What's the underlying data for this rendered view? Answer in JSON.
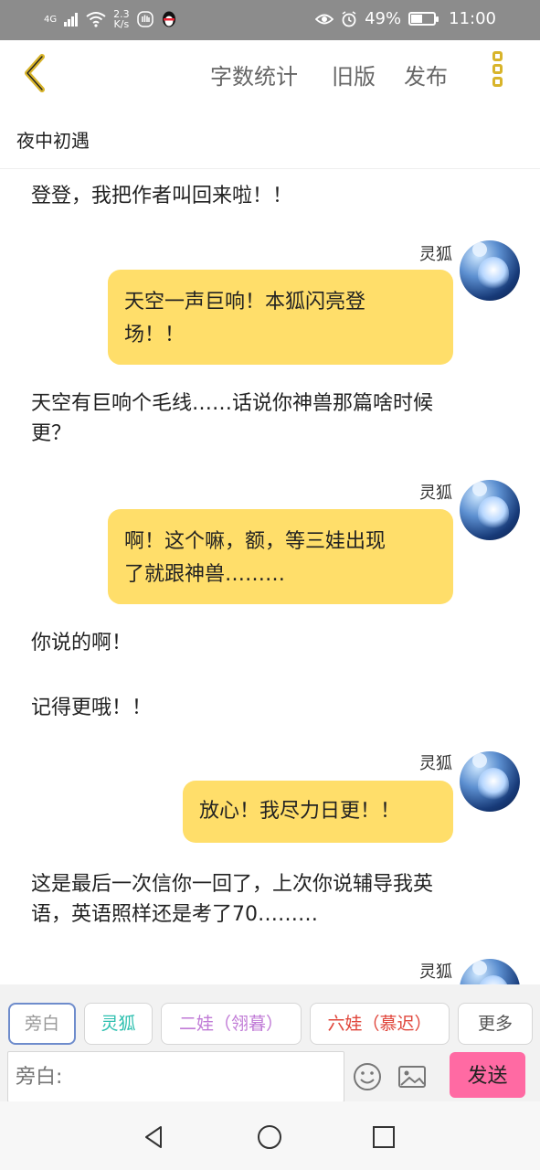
{
  "status_bar": {
    "network": "4G",
    "speed_value": "2.3",
    "speed_unit": "K/s",
    "battery": "49%",
    "battery_level": 0.49,
    "time": "11:00"
  },
  "header": {
    "back_icon": "chevron-left-icon",
    "links": [
      "字数统计",
      "旧版",
      "发布"
    ],
    "more_icon": "three-squares-icon",
    "accent_color": "#d8b42a"
  },
  "story": {
    "title": "夜中初遇"
  },
  "messages": [
    {
      "type": "narration",
      "text": "登登，我把作者叫回来啦！！"
    },
    {
      "type": "character",
      "sender": "灵狐",
      "text_lines": [
        "天空一声巨响！本狐闪亮登",
        "场！！"
      ]
    },
    {
      "type": "narration",
      "text_lines": [
        "天空有巨响个毛线……话说你神兽那篇啥时候",
        "更？"
      ]
    },
    {
      "type": "character",
      "sender": "灵狐",
      "text_lines": [
        "啊！这个嘛，额，等三娃出现",
        "了就跟神兽………"
      ]
    },
    {
      "type": "narration",
      "text": "你说的啊！"
    },
    {
      "type": "narration",
      "text": "记得更哦！！"
    },
    {
      "type": "character",
      "sender": "灵狐",
      "text_lines": [
        "放心！我尽力日更！！"
      ]
    },
    {
      "type": "narration",
      "text_lines": [
        "这是最后一次信你一回了，上次你说辅导我英",
        "语，英语照样还是考了70………"
      ]
    },
    {
      "type": "character",
      "sender": "灵狐",
      "text_lines": []
    }
  ],
  "roles": [
    {
      "label": "旁白",
      "color": "#999999",
      "active": true
    },
    {
      "label": "灵狐",
      "color": "#2bbfae",
      "active": false
    },
    {
      "label": "二娃（翎暮）",
      "color": "#c07ad6",
      "active": false
    },
    {
      "label": "六娃（慕迟）",
      "color": "#e0463b",
      "active": false
    },
    {
      "label": "更多",
      "color": "#555555",
      "active": false
    }
  ],
  "composer": {
    "placeholder": "旁白:",
    "emoji_icon": "smiley-icon",
    "image_icon": "image-icon",
    "send_label": "发送",
    "send_color": "#ff6aa3"
  },
  "nav": {
    "icons": [
      "back-triangle-icon",
      "home-circle-icon",
      "recents-square-icon"
    ]
  }
}
